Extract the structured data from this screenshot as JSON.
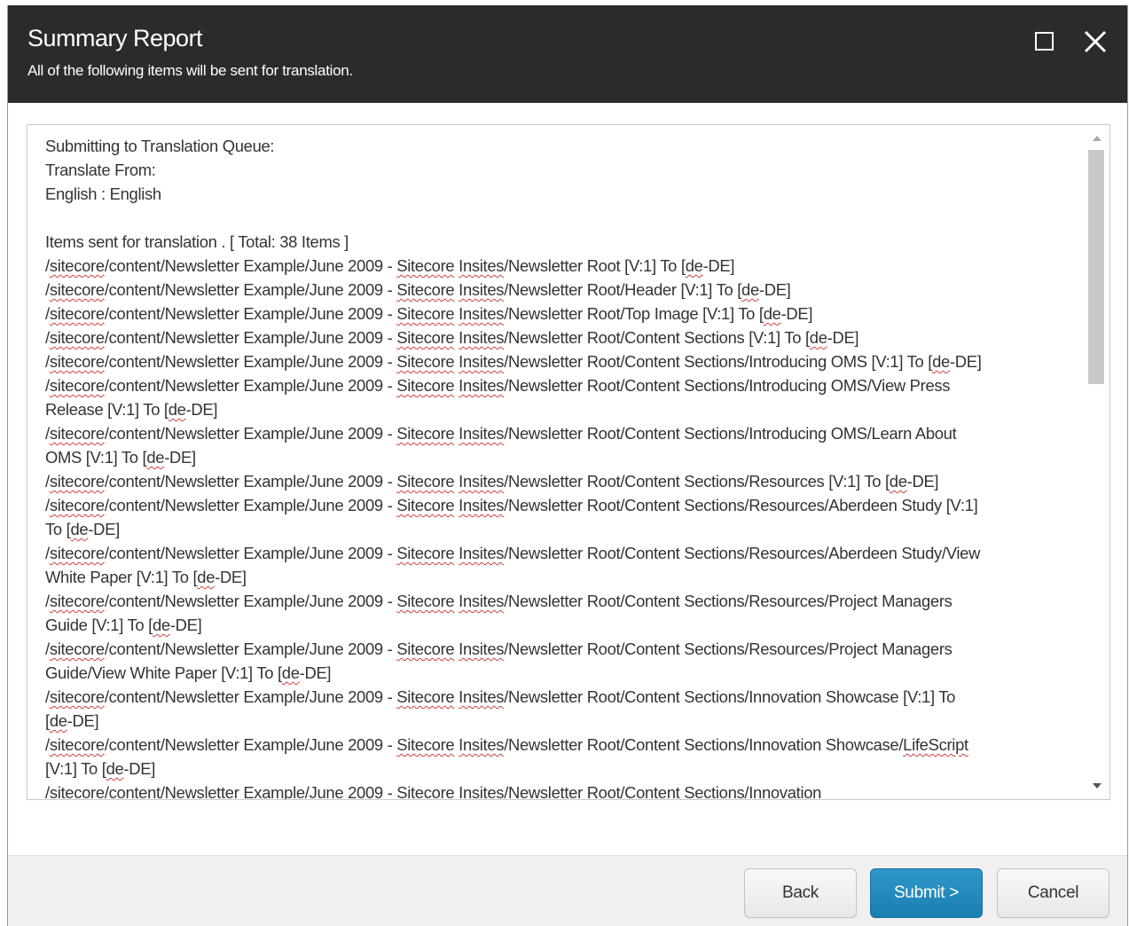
{
  "dialog": {
    "title": "Summary Report",
    "subtitle": "All of the following items will be sent for translation."
  },
  "content": {
    "lines": [
      "Submitting to Translation Queue:",
      "Translate From:",
      "English : English",
      "",
      "Items sent for translation . [ Total: 38 Items ]",
      "/sitecore/content/Newsletter Example/June 2009 - Sitecore Insites/Newsletter Root [V:1] To [de-DE]",
      "/sitecore/content/Newsletter Example/June 2009 - Sitecore Insites/Newsletter Root/Header [V:1] To [de-DE]",
      "/sitecore/content/Newsletter Example/June 2009 - Sitecore Insites/Newsletter Root/Top Image [V:1] To [de-DE]",
      "/sitecore/content/Newsletter Example/June 2009 - Sitecore Insites/Newsletter Root/Content Sections [V:1] To [de-DE]",
      "/sitecore/content/Newsletter Example/June 2009 - Sitecore Insites/Newsletter Root/Content Sections/Introducing OMS [V:1] To [de-DE]",
      "/sitecore/content/Newsletter Example/June 2009 - Sitecore Insites/Newsletter Root/Content Sections/Introducing OMS/View Press",
      "Release [V:1] To [de-DE]",
      "/sitecore/content/Newsletter Example/June 2009 - Sitecore Insites/Newsletter Root/Content Sections/Introducing OMS/Learn About",
      "OMS [V:1] To [de-DE]",
      "/sitecore/content/Newsletter Example/June 2009 - Sitecore Insites/Newsletter Root/Content Sections/Resources [V:1] To [de-DE]",
      "/sitecore/content/Newsletter Example/June 2009 - Sitecore Insites/Newsletter Root/Content Sections/Resources/Aberdeen Study [V:1]",
      "To [de-DE]",
      "/sitecore/content/Newsletter Example/June 2009 - Sitecore Insites/Newsletter Root/Content Sections/Resources/Aberdeen Study/View",
      "White Paper [V:1] To [de-DE]",
      "/sitecore/content/Newsletter Example/June 2009 - Sitecore Insites/Newsletter Root/Content Sections/Resources/Project Managers",
      "Guide [V:1] To [de-DE]",
      "/sitecore/content/Newsletter Example/June 2009 - Sitecore Insites/Newsletter Root/Content Sections/Resources/Project Managers",
      "Guide/View White Paper [V:1] To [de-DE]",
      "/sitecore/content/Newsletter Example/June 2009 - Sitecore Insites/Newsletter Root/Content Sections/Innovation Showcase [V:1] To",
      "[de-DE]",
      "/sitecore/content/Newsletter Example/June 2009 - Sitecore Insites/Newsletter Root/Content Sections/Innovation Showcase/LifeScript",
      "[V:1] To [de-DE]",
      "/sitecore/content/Newsletter Example/June 2009 - Sitecore Insites/Newsletter Root/Content Sections/Innovation"
    ],
    "spellcheck_words": [
      "sitecore",
      "Sitecore",
      "Insites",
      "de",
      "LifeScript"
    ]
  },
  "buttons": {
    "back_label": "Back",
    "submit_label": "Submit >",
    "cancel_label": "Cancel"
  },
  "colors": {
    "header_bg": "#2b2b2b",
    "primary_button": "#1a7eb0",
    "spellcheck_underline": "#d04040"
  },
  "icons": {
    "maximize": "maximize-icon",
    "close": "close-icon",
    "scroll_up": "scroll-up-arrow-icon",
    "scroll_down": "scroll-down-arrow-icon"
  }
}
